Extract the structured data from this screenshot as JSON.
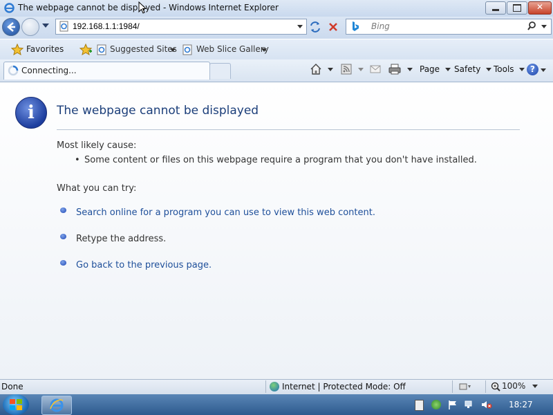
{
  "window": {
    "title": "The webpage cannot be displayed - Windows Internet Explorer"
  },
  "address_bar": {
    "url": "192.168.1.1:1984/"
  },
  "search": {
    "placeholder": "Bing"
  },
  "favorites_bar": {
    "favorites_label": "Favorites",
    "suggested_sites": "Suggested Sites",
    "web_slice_gallery": "Web Slice Gallery"
  },
  "tab": {
    "label": "Connecting..."
  },
  "command_bar": {
    "page": "Page",
    "safety": "Safety",
    "tools": "Tools"
  },
  "content": {
    "heading": "The webpage cannot be displayed",
    "cause_label": "Most likely cause:",
    "cause_item": "Some content or files on this webpage require a program that you don't have installed.",
    "try_label": "What you can try:",
    "actions": [
      {
        "text": "Search online for a program you can use to view this web content.",
        "link": true
      },
      {
        "text": "Retype the address.",
        "link": false
      },
      {
        "text": "Go back to the previous page.",
        "link": true
      }
    ]
  },
  "status_bar": {
    "status": "Done",
    "zone": "Internet | Protected Mode: Off",
    "zoom": "100%"
  },
  "taskbar": {
    "clock": "18:27"
  }
}
